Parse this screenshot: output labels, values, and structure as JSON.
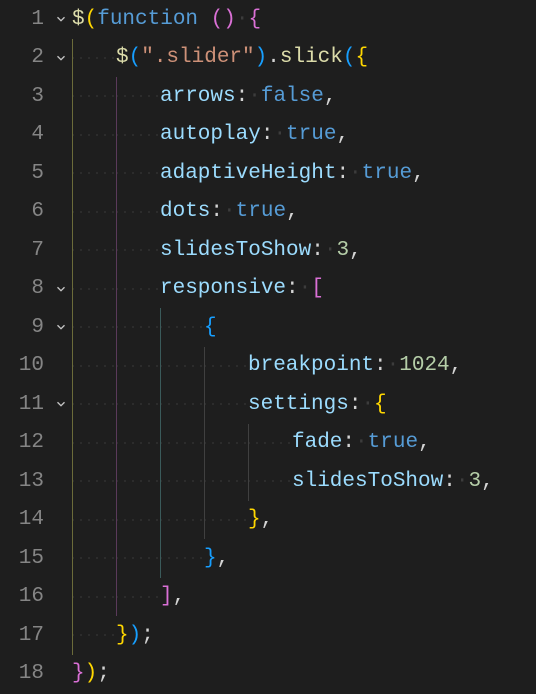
{
  "lines": [
    {
      "num": "1",
      "fold": true,
      "indent": 0,
      "tokens": [
        [
          "fn",
          "$"
        ],
        [
          "br1",
          "("
        ],
        [
          "kw",
          "function "
        ],
        [
          "br2",
          "("
        ],
        [
          "br2",
          ")"
        ],
        [
          "ws",
          " "
        ],
        [
          "br2",
          "{"
        ]
      ]
    },
    {
      "num": "2",
      "fold": true,
      "indent": 1,
      "tokens": [
        [
          "fn",
          "$"
        ],
        [
          "br3",
          "("
        ],
        [
          "str",
          "\".slider\""
        ],
        [
          "br3",
          ")"
        ],
        [
          "pn",
          "."
        ],
        [
          "fn",
          "slick"
        ],
        [
          "br3",
          "("
        ],
        [
          "br1",
          "{"
        ]
      ]
    },
    {
      "num": "3",
      "fold": false,
      "indent": 2,
      "tokens": [
        [
          "prop",
          "arrows"
        ],
        [
          "pn",
          ":"
        ],
        [
          "ws",
          " "
        ],
        [
          "bool",
          "false"
        ],
        [
          "pn",
          ","
        ]
      ]
    },
    {
      "num": "4",
      "fold": false,
      "indent": 2,
      "tokens": [
        [
          "prop",
          "autoplay"
        ],
        [
          "pn",
          ":"
        ],
        [
          "ws",
          " "
        ],
        [
          "bool",
          "true"
        ],
        [
          "pn",
          ","
        ]
      ]
    },
    {
      "num": "5",
      "fold": false,
      "indent": 2,
      "tokens": [
        [
          "prop",
          "adaptiveHeight"
        ],
        [
          "pn",
          ":"
        ],
        [
          "ws",
          " "
        ],
        [
          "bool",
          "true"
        ],
        [
          "pn",
          ","
        ]
      ]
    },
    {
      "num": "6",
      "fold": false,
      "indent": 2,
      "tokens": [
        [
          "prop",
          "dots"
        ],
        [
          "pn",
          ":"
        ],
        [
          "ws",
          " "
        ],
        [
          "bool",
          "true"
        ],
        [
          "pn",
          ","
        ]
      ]
    },
    {
      "num": "7",
      "fold": false,
      "indent": 2,
      "tokens": [
        [
          "prop",
          "slidesToShow"
        ],
        [
          "pn",
          ":"
        ],
        [
          "ws",
          " "
        ],
        [
          "num",
          "3"
        ],
        [
          "pn",
          ","
        ]
      ]
    },
    {
      "num": "8",
      "fold": true,
      "indent": 2,
      "tokens": [
        [
          "prop",
          "responsive"
        ],
        [
          "pn",
          ":"
        ],
        [
          "ws",
          " "
        ],
        [
          "br2",
          "["
        ]
      ]
    },
    {
      "num": "9",
      "fold": true,
      "indent": 3,
      "tokens": [
        [
          "br3",
          "{"
        ]
      ]
    },
    {
      "num": "10",
      "fold": false,
      "indent": 4,
      "tokens": [
        [
          "prop",
          "breakpoint"
        ],
        [
          "pn",
          ":"
        ],
        [
          "ws",
          " "
        ],
        [
          "num",
          "1024"
        ],
        [
          "pn",
          ","
        ]
      ]
    },
    {
      "num": "11",
      "fold": true,
      "indent": 4,
      "tokens": [
        [
          "prop",
          "settings"
        ],
        [
          "pn",
          ":"
        ],
        [
          "ws",
          " "
        ],
        [
          "br1",
          "{"
        ]
      ]
    },
    {
      "num": "12",
      "fold": false,
      "indent": 5,
      "tokens": [
        [
          "prop",
          "fade"
        ],
        [
          "pn",
          ":"
        ],
        [
          "ws",
          " "
        ],
        [
          "bool",
          "true"
        ],
        [
          "pn",
          ","
        ]
      ]
    },
    {
      "num": "13",
      "fold": false,
      "indent": 5,
      "tokens": [
        [
          "prop",
          "slidesToShow"
        ],
        [
          "pn",
          ":"
        ],
        [
          "ws",
          " "
        ],
        [
          "num",
          "3"
        ],
        [
          "pn",
          ","
        ]
      ]
    },
    {
      "num": "14",
      "fold": false,
      "indent": 4,
      "tokens": [
        [
          "br1",
          "}"
        ],
        [
          "pn",
          ","
        ]
      ]
    },
    {
      "num": "15",
      "fold": false,
      "indent": 3,
      "tokens": [
        [
          "br3",
          "}"
        ],
        [
          "pn",
          ","
        ]
      ]
    },
    {
      "num": "16",
      "fold": false,
      "indent": 2,
      "tokens": [
        [
          "br2",
          "]"
        ],
        [
          "pn",
          ","
        ]
      ]
    },
    {
      "num": "17",
      "fold": false,
      "indent": 1,
      "tokens": [
        [
          "br1",
          "}"
        ],
        [
          "br3",
          ")"
        ],
        [
          "pn",
          ";"
        ]
      ]
    },
    {
      "num": "18",
      "fold": false,
      "indent": 0,
      "tokens": [
        [
          "br2",
          "}"
        ],
        [
          "br1",
          ")"
        ],
        [
          "pn",
          ";"
        ]
      ]
    }
  ]
}
